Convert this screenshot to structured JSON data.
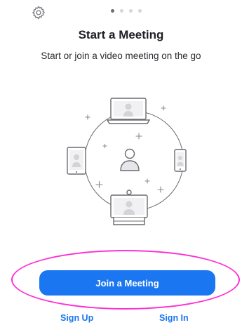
{
  "header": {
    "settings_icon": "gear-icon",
    "pager": {
      "count": 4,
      "active_index": 0
    }
  },
  "main": {
    "title": "Start a Meeting",
    "subtitle": "Start or join a video meeting on the go",
    "illustration_icons": [
      "laptop-icon",
      "tablet-icon",
      "phone-icon",
      "room-display-icon",
      "user-icon"
    ]
  },
  "actions": {
    "join_label": "Join a Meeting",
    "signup_label": "Sign Up",
    "signin_label": "Sign In"
  },
  "colors": {
    "accent": "#1a76f1",
    "highlight_oval": "#ff2dd3"
  }
}
